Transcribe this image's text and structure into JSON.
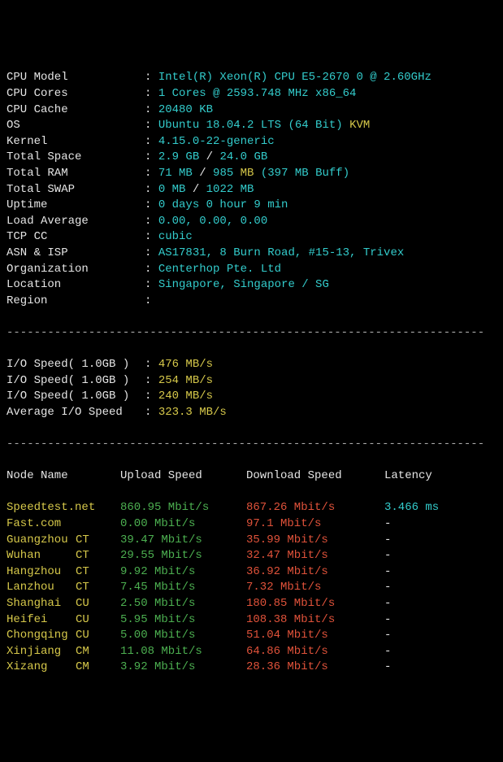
{
  "sys": [
    {
      "label": "CPU Model",
      "parts": [
        {
          "t": "Intel(R) Xeon(R) CPU E5-2670 0 @ 2.60GHz",
          "cls": "c"
        }
      ]
    },
    {
      "label": "CPU Cores",
      "parts": [
        {
          "t": "1 Cores @ 2593.748 MHz x86_64",
          "cls": "c"
        }
      ]
    },
    {
      "label": "CPU Cache",
      "parts": [
        {
          "t": "20480 KB",
          "cls": "c"
        }
      ]
    },
    {
      "label": "OS",
      "parts": [
        {
          "t": "Ubuntu 18.04.2 LTS (64 Bit) ",
          "cls": "c"
        },
        {
          "t": "KVM",
          "cls": "y"
        }
      ]
    },
    {
      "label": "Kernel",
      "parts": [
        {
          "t": "4.15.0-22-generic",
          "cls": "c"
        }
      ]
    },
    {
      "label": "Total Space",
      "parts": [
        {
          "t": "2.9 GB ",
          "cls": "c"
        },
        {
          "t": "/ ",
          "cls": "w"
        },
        {
          "t": "24.0 GB",
          "cls": "c"
        }
      ]
    },
    {
      "label": "Total RAM",
      "parts": [
        {
          "t": "71 MB ",
          "cls": "c"
        },
        {
          "t": "/ ",
          "cls": "w"
        },
        {
          "t": "985 ",
          "cls": "c"
        },
        {
          "t": "MB ",
          "cls": "y"
        },
        {
          "t": "(397 MB Buff)",
          "cls": "c"
        }
      ]
    },
    {
      "label": "Total SWAP",
      "parts": [
        {
          "t": "0 MB ",
          "cls": "c"
        },
        {
          "t": "/ ",
          "cls": "w"
        },
        {
          "t": "1022 MB",
          "cls": "c"
        }
      ]
    },
    {
      "label": "Uptime",
      "parts": [
        {
          "t": "0 days 0 hour 9 min",
          "cls": "c"
        }
      ]
    },
    {
      "label": "Load Average",
      "parts": [
        {
          "t": "0.00, 0.00, 0.00",
          "cls": "c"
        }
      ]
    },
    {
      "label": "TCP CC",
      "parts": [
        {
          "t": "cubic",
          "cls": "c"
        }
      ]
    },
    {
      "label": "ASN & ISP",
      "parts": [
        {
          "t": "AS17831, 8 Burn Road, #15-13, Trivex",
          "cls": "c"
        }
      ]
    },
    {
      "label": "Organization",
      "parts": [
        {
          "t": "Centerhop Pte. Ltd",
          "cls": "c"
        }
      ]
    },
    {
      "label": "Location",
      "parts": [
        {
          "t": "Singapore, Singapore / SG",
          "cls": "c"
        }
      ]
    },
    {
      "label": "Region",
      "parts": []
    }
  ],
  "io": [
    {
      "label": "I/O Speed( 1.0GB )",
      "parts": [
        {
          "t": "476 MB/s",
          "cls": "y"
        }
      ]
    },
    {
      "label": "I/O Speed( 1.0GB )",
      "parts": [
        {
          "t": "254 MB/s",
          "cls": "y"
        }
      ]
    },
    {
      "label": "I/O Speed( 1.0GB )",
      "parts": [
        {
          "t": "240 MB/s",
          "cls": "y"
        }
      ]
    },
    {
      "label": "Average I/O Speed",
      "parts": [
        {
          "t": "323.3 MB/s",
          "cls": "y"
        }
      ]
    }
  ],
  "speed_headers": {
    "node": "Node Name",
    "up": "Upload Speed",
    "down": "Download Speed",
    "lat": "Latency"
  },
  "speed": [
    {
      "name": "Speedtest.net",
      "tag": "",
      "ncls": "y",
      "up": "860.95 Mbit/s",
      "down": "867.26 Mbit/s",
      "lat": "3.466 ms"
    },
    {
      "name": "Fast.com",
      "tag": "",
      "ncls": "y",
      "up": "0.00 Mbit/s",
      "down": "97.1 Mbit/s",
      "lat": "-"
    },
    {
      "name": "Guangzhou",
      "tag": "CT",
      "ncls": "y",
      "up": "39.47 Mbit/s",
      "down": "35.99 Mbit/s",
      "lat": "-"
    },
    {
      "name": "Wuhan",
      "tag": "CT",
      "ncls": "y",
      "up": "29.55 Mbit/s",
      "down": "32.47 Mbit/s",
      "lat": "-"
    },
    {
      "name": "Hangzhou",
      "tag": "CT",
      "ncls": "y",
      "up": "9.92 Mbit/s",
      "down": "36.92 Mbit/s",
      "lat": "-"
    },
    {
      "name": "Lanzhou",
      "tag": "CT",
      "ncls": "y",
      "up": "7.45 Mbit/s",
      "down": "7.32 Mbit/s",
      "lat": "-"
    },
    {
      "name": "Shanghai",
      "tag": "CU",
      "ncls": "y",
      "up": "2.50 Mbit/s",
      "down": "180.85 Mbit/s",
      "lat": "-"
    },
    {
      "name": "Heifei",
      "tag": "CU",
      "ncls": "y",
      "up": "5.95 Mbit/s",
      "down": "108.38 Mbit/s",
      "lat": "-"
    },
    {
      "name": "Chongqing",
      "tag": "CU",
      "ncls": "y",
      "up": "5.00 Mbit/s",
      "down": "51.04 Mbit/s",
      "lat": "-"
    },
    {
      "name": "Xinjiang",
      "tag": "CM",
      "ncls": "y",
      "up": "11.08 Mbit/s",
      "down": "64.86 Mbit/s",
      "lat": "-"
    },
    {
      "name": "Xizang",
      "tag": "CM",
      "ncls": "y",
      "up": "3.92 Mbit/s",
      "down": "28.36 Mbit/s",
      "lat": "-"
    }
  ],
  "hr": "----------------------------------------------------------------------"
}
